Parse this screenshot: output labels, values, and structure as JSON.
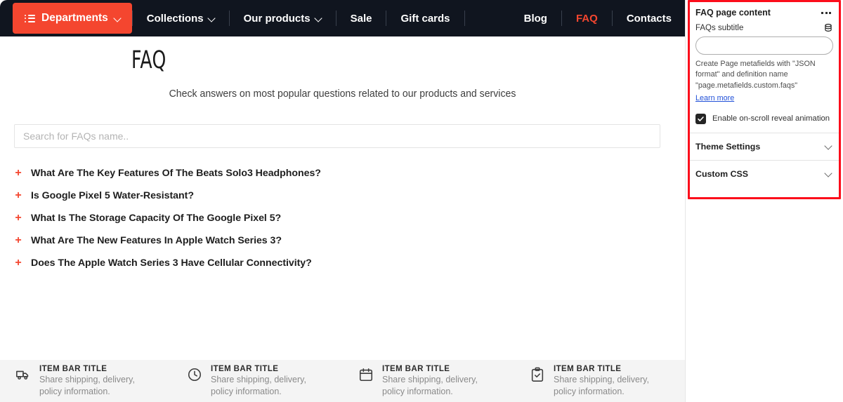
{
  "nav": {
    "departments": {
      "label": "Departments",
      "icon": "list-icon",
      "caret": "chevron-down-icon"
    },
    "items": [
      {
        "label": "Collections",
        "caret": true,
        "accent": false
      },
      {
        "label": "Our products",
        "caret": true,
        "accent": false
      },
      {
        "label": "Sale",
        "caret": false,
        "accent": false
      },
      {
        "label": "Gift cards",
        "caret": false,
        "accent": false
      }
    ],
    "right_items": [
      {
        "label": "Blog",
        "accent": false
      },
      {
        "label": "FAQ",
        "accent": true
      },
      {
        "label": "Contacts",
        "accent": false
      }
    ],
    "bg_color": "#10151f",
    "accent_color": "#f4462f"
  },
  "page": {
    "title": "FAQ",
    "subtitle": "Check answers on most popular questions related to our products and services",
    "search_placeholder": "Search for FAQs name..",
    "search_value": "",
    "questions": [
      "What Are The Key Features Of The Beats Solo3 Headphones?",
      "Is Google Pixel 5 Water-Resistant?",
      "What Is The Storage Capacity Of The Google Pixel 5?",
      "What Are The New Features In Apple Watch Series 3?",
      "Does The Apple Watch Series 3 Have Cellular Connectivity?"
    ],
    "expand_symbol": "+"
  },
  "item_bar": [
    {
      "icon": "truck-icon",
      "title": "ITEM BAR TITLE",
      "desc": "Share shipping, delivery, policy information."
    },
    {
      "icon": "clock-icon",
      "title": "ITEM BAR TITLE",
      "desc": "Share shipping, delivery, policy information."
    },
    {
      "icon": "calendar-icon",
      "title": "ITEM BAR TITLE",
      "desc": "Share shipping, delivery, policy information."
    },
    {
      "icon": "clipboard-check-icon",
      "title": "ITEM BAR TITLE",
      "desc": "Share shipping, delivery, policy information."
    }
  ],
  "inspector": {
    "title": "FAQ page content",
    "more_menu": "more-options",
    "field": {
      "label": "FAQs subtitle",
      "metafield_icon": "database-icon",
      "value": "",
      "placeholder": ""
    },
    "help_text": "Create Page metafields with \"JSON format\" and definition name \"page.metafields.custom.faqs\"",
    "help_link": "Learn more",
    "checkbox": {
      "label": "Enable on-scroll reveal animation",
      "checked": true
    },
    "sections": [
      {
        "label": "Theme Settings",
        "caret": "chevron-down-icon"
      },
      {
        "label": "Custom CSS",
        "caret": "chevron-down-icon"
      }
    ],
    "highlight_color": "#fc0d1b"
  }
}
